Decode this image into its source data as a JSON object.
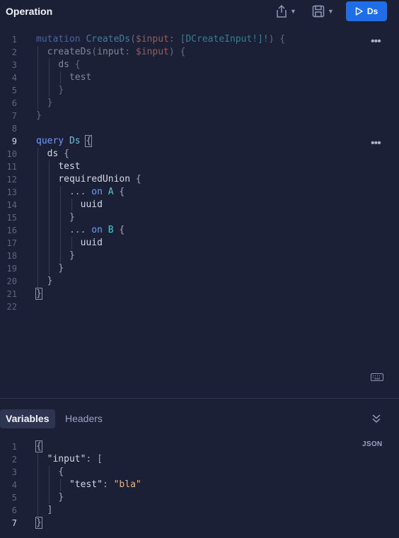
{
  "header": {
    "title": "Operation",
    "run_label": "Ds"
  },
  "operation_editor": {
    "line_numbers": [
      "1",
      "2",
      "3",
      "4",
      "5",
      "6",
      "7",
      "8",
      "9",
      "10",
      "11",
      "12",
      "13",
      "14",
      "15",
      "16",
      "17",
      "18",
      "19",
      "20",
      "21",
      "22"
    ],
    "mutation": {
      "keyword": "mutation",
      "name": "CreateDs",
      "var": "$input",
      "type": "[DCreateInput!]!",
      "field": "createDs",
      "arg": "input",
      "ds": "ds",
      "test": "test"
    },
    "query": {
      "keyword": "query",
      "name": "Ds",
      "ds": "ds",
      "test": "test",
      "union": "requiredUnion",
      "spread": "...",
      "on": "on",
      "type_a": "A",
      "type_b": "B",
      "uuid": "uuid"
    }
  },
  "tabs": {
    "variables": "Variables",
    "headers": "Headers"
  },
  "variables_editor": {
    "badge": "JSON",
    "line_numbers": [
      "1",
      "2",
      "3",
      "4",
      "5",
      "6",
      "7"
    ],
    "key_input": "\"input\"",
    "key_test": "\"test\"",
    "value_test": "\"bla\""
  },
  "icons": {
    "share": "share-icon",
    "save": "save-icon",
    "run": "play-icon",
    "more": "more-dots-icon",
    "keyboard": "keyboard-icon",
    "collapse": "chevrons-down-icon"
  },
  "colors": {
    "background": "#1b2036",
    "accent": "#1f6ee8",
    "keyword": "#6f9cff",
    "type": "#4fc9cf",
    "variable": "#ff8a70",
    "string": "#f0b37e"
  }
}
